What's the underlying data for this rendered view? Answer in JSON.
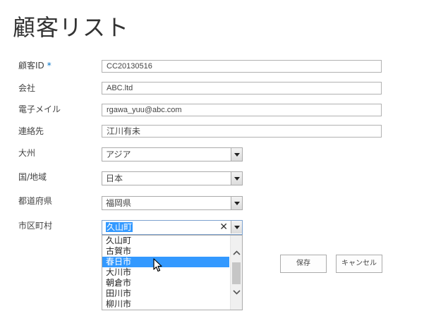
{
  "page": {
    "title": "顧客リスト"
  },
  "form": {
    "customer_id": {
      "label": "顧客ID",
      "required_mark": "*",
      "value": "CC20130516"
    },
    "company": {
      "label": "会社",
      "value": "ABC.ltd"
    },
    "email": {
      "label": "電子メイル",
      "value": "rgawa_yuu@abc.com"
    },
    "contact": {
      "label": "連絡先",
      "value": "江川有未"
    },
    "continent": {
      "label": "大州",
      "value": "アジア"
    },
    "country": {
      "label": "国/地域",
      "value": "日本"
    },
    "prefecture": {
      "label": "都道府県",
      "value": "福岡県"
    },
    "city": {
      "label": "市区町村",
      "value": "久山町",
      "clear_glyph": "✕",
      "options": [
        "久山町",
        "古賀市",
        "春日市",
        "大川市",
        "朝倉市",
        "田川市",
        "柳川市"
      ],
      "highlighted_index": 2
    }
  },
  "buttons": {
    "save": "保存",
    "cancel": "キャンセル"
  }
}
